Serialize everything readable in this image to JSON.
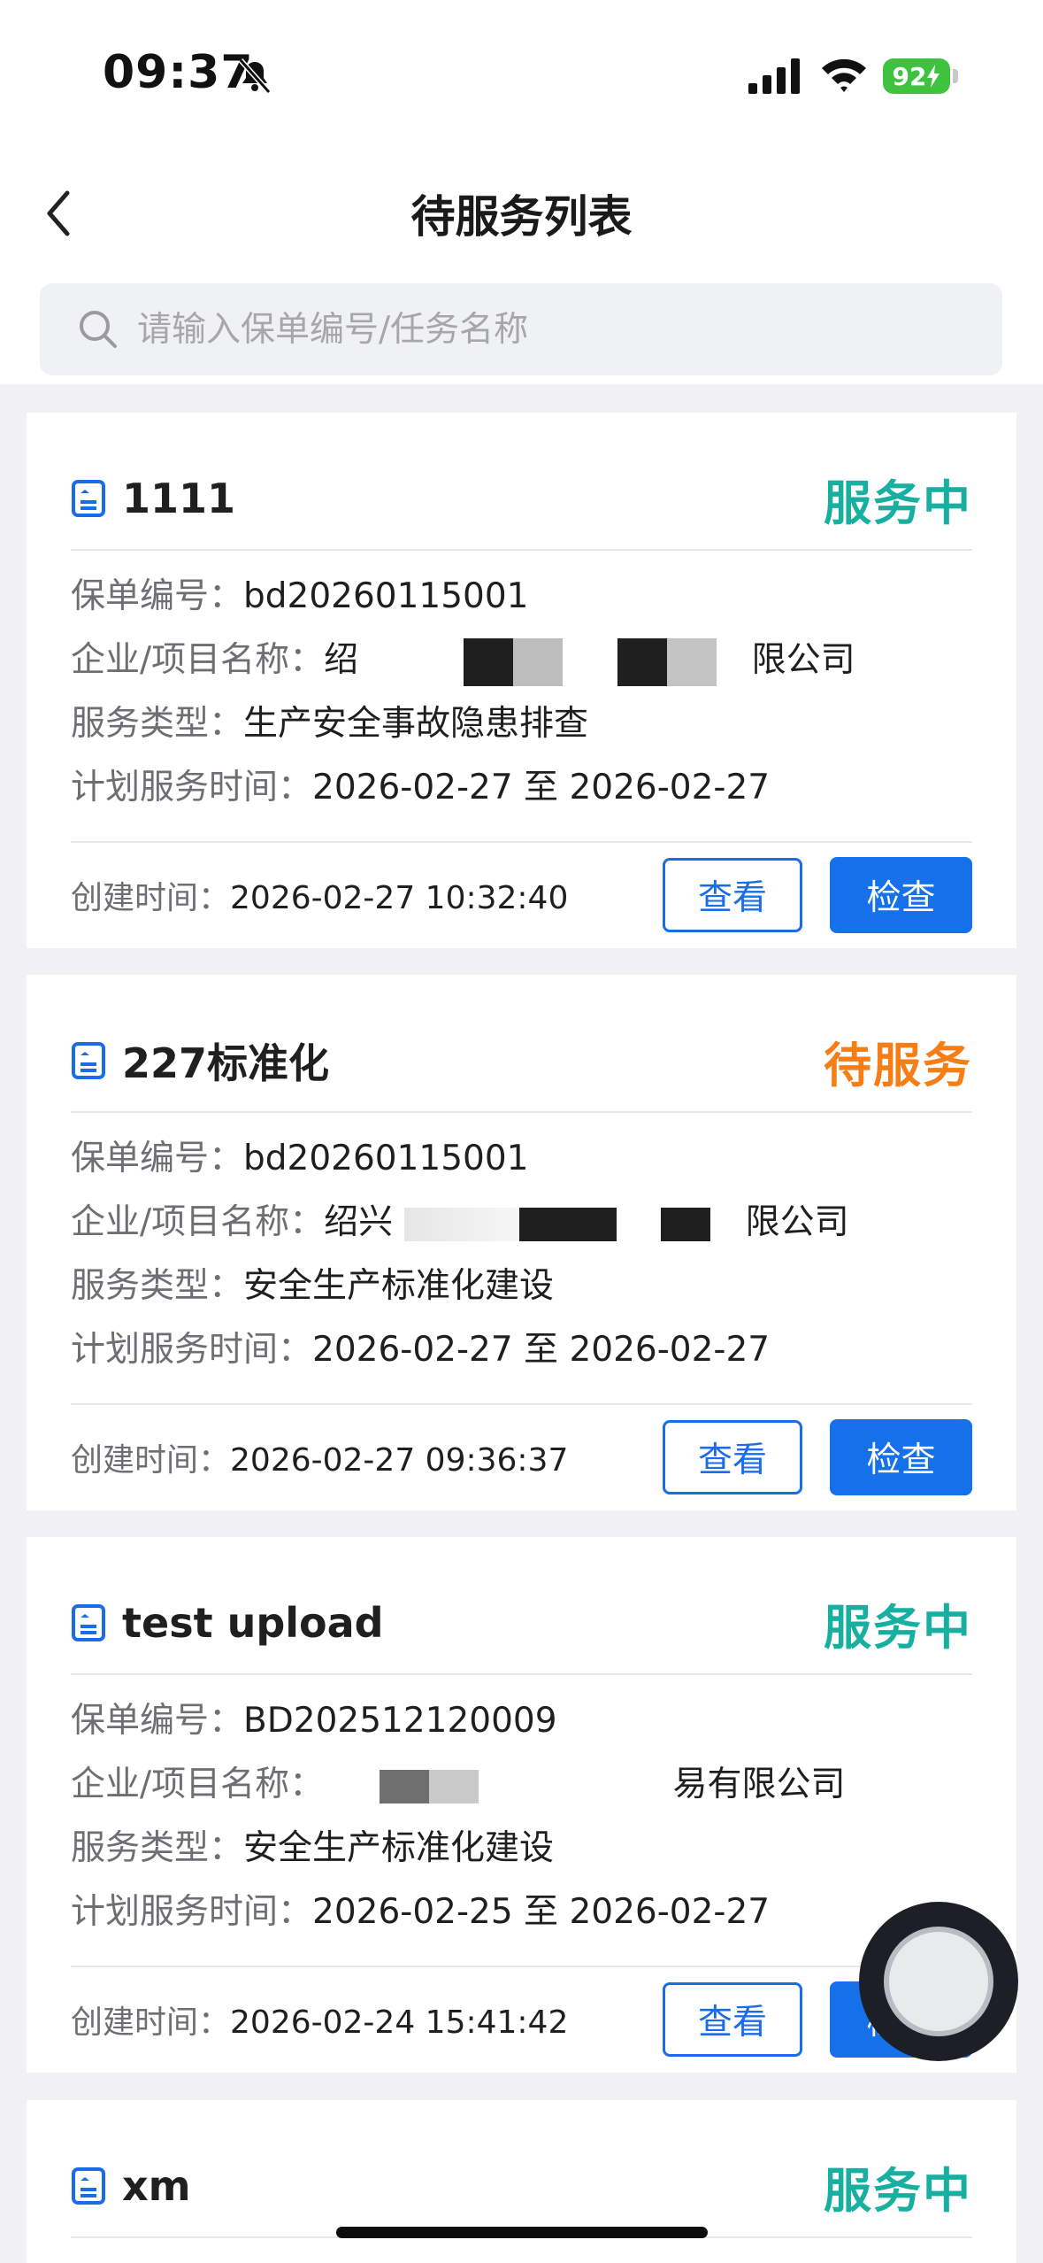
{
  "status_bar": {
    "time": "09:37",
    "battery": "92"
  },
  "header": {
    "title": "待服务列表"
  },
  "search": {
    "placeholder": "请输入保单编号/任务名称"
  },
  "labels": {
    "policy_no": "保单编号：",
    "company": "企业/项目名称：",
    "service_type": "服务类型：",
    "plan_time": "计划服务时间：",
    "created": "创建时间：",
    "view": "查看",
    "check": "检查"
  },
  "cards": [
    {
      "title": "1111",
      "status": "服务中",
      "policy_no": "bd20260115001",
      "company_prefix": "绍",
      "company_suffix": "限公司",
      "service_type": "生产安全事故隐患排查",
      "plan_time": "2026-02-27 至 2026-02-27",
      "created": "2026-02-27 10:32:40"
    },
    {
      "title": "227标准化",
      "status": "待服务",
      "policy_no": "bd20260115001",
      "company_prefix": "绍兴",
      "company_suffix": "限公司",
      "service_type": "安全生产标准化建设",
      "plan_time": "2026-02-27 至 2026-02-27",
      "created": "2026-02-27 09:36:37"
    },
    {
      "title": "test upload",
      "status": "服务中",
      "policy_no": "BD202512120009",
      "company_prefix": "",
      "company_suffix": "易有限公司",
      "service_type": "安全生产标准化建设",
      "plan_time": "2026-02-25 至 2026-02-27",
      "created": "2026-02-24 15:41:42"
    },
    {
      "title": "xm",
      "status": "服务中"
    }
  ],
  "colors": {
    "status_active": "#17b0a0",
    "status_pending": "#f57f16",
    "primary_button": "#1570ea"
  }
}
